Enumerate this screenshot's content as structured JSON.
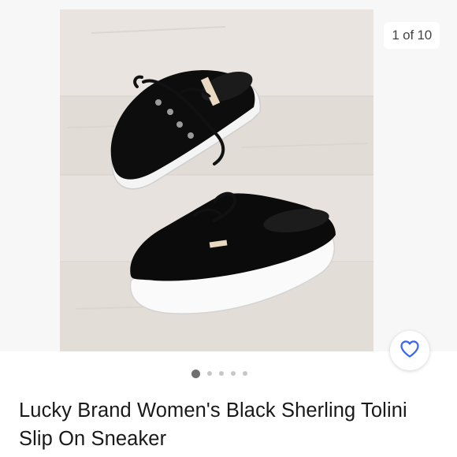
{
  "listing": {
    "image_counter": "1 of 10",
    "title": "Lucky Brand Women's Black Sherling Tolini Slip On Sneaker"
  },
  "gallery": {
    "dot_count": 5,
    "active_dot": 1
  },
  "icons": {
    "favorite": "heart-icon"
  },
  "colors": {
    "accent": "#3665f3",
    "text": "#191919"
  }
}
